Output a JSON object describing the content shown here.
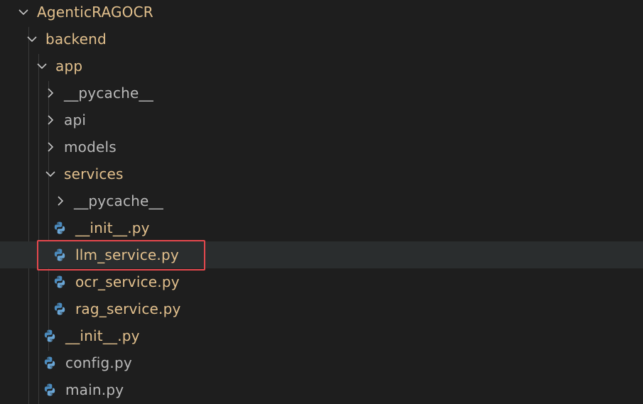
{
  "tree": {
    "root": {
      "label": "AgenticRAGOCR",
      "expanded": true
    },
    "backend": {
      "label": "backend",
      "expanded": true
    },
    "app": {
      "label": "app",
      "expanded": true
    },
    "app_pycache": {
      "label": "__pycache__",
      "expanded": false
    },
    "api": {
      "label": "api",
      "expanded": false
    },
    "models": {
      "label": "models",
      "expanded": false
    },
    "services": {
      "label": "services",
      "expanded": true
    },
    "services_pycache": {
      "label": "__pycache__",
      "expanded": false
    },
    "services_init": {
      "label": "__init__.py",
      "icon": "python-icon"
    },
    "llm_service": {
      "label": "llm_service.py",
      "icon": "python-icon",
      "selected": true
    },
    "ocr_service": {
      "label": "ocr_service.py",
      "icon": "python-icon"
    },
    "rag_service": {
      "label": "rag_service.py",
      "icon": "python-icon"
    },
    "app_init": {
      "label": "__init__.py",
      "icon": "python-icon"
    },
    "config": {
      "label": "config.py",
      "icon": "python-icon"
    },
    "main": {
      "label": "main.py",
      "icon": "python-icon"
    }
  },
  "colors": {
    "background": "#1e1e1e",
    "folder_text": "#e2c08d",
    "muted_text": "#b9b9b9",
    "python_blue": "#4b8bbe",
    "python_light": "#6aa6d6",
    "highlight": "#e5484d",
    "selected_row": "#2a2d2e"
  }
}
